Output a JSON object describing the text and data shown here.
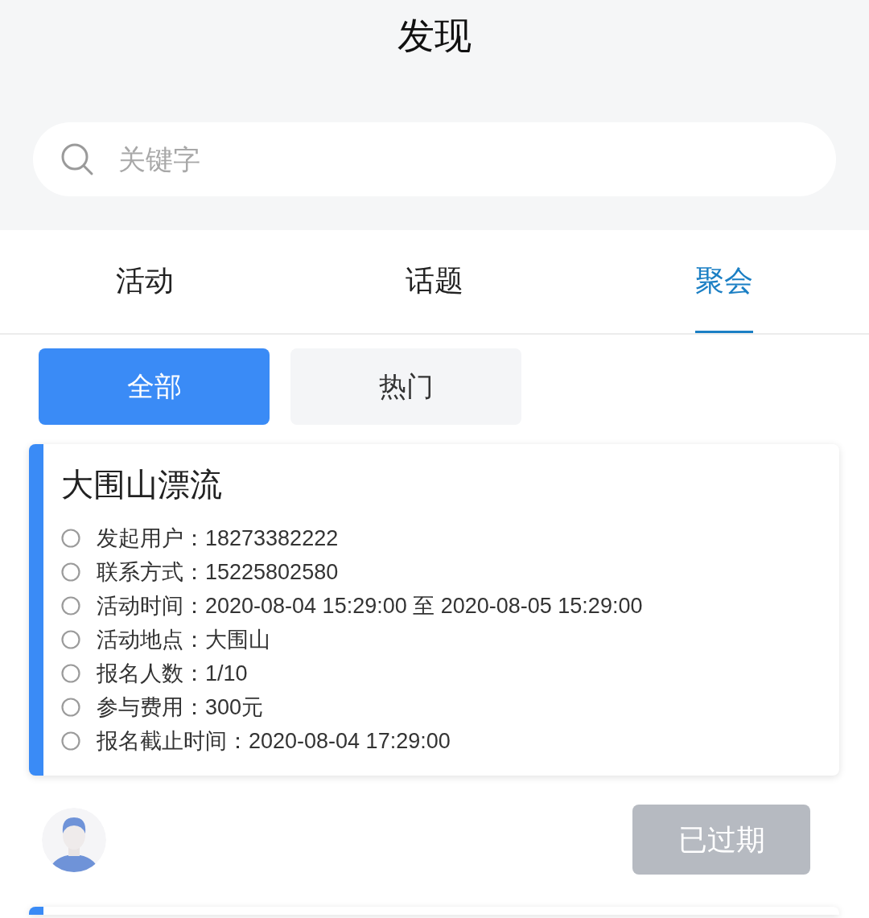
{
  "header": {
    "title": "发现"
  },
  "search": {
    "placeholder": "关键字"
  },
  "tabs": [
    {
      "label": "活动",
      "selected": false
    },
    {
      "label": "话题",
      "selected": false
    },
    {
      "label": "聚会",
      "selected": true
    }
  ],
  "filters": [
    {
      "label": "全部",
      "selected": true
    },
    {
      "label": "热门",
      "selected": false
    }
  ],
  "cards": [
    {
      "title": "大围山漂流",
      "details": [
        "发起用户：18273382222",
        "联系方式：15225802580",
        "活动时间：2020-08-04 15:29:00 至 2020-08-05 15:29:00",
        "活动地点：大围山",
        "报名人数：1/10",
        "参与费用：300元",
        "报名截止时间：2020-08-04 17:29:00"
      ],
      "action": {
        "label": "已过期",
        "disabled": true
      }
    }
  ]
}
